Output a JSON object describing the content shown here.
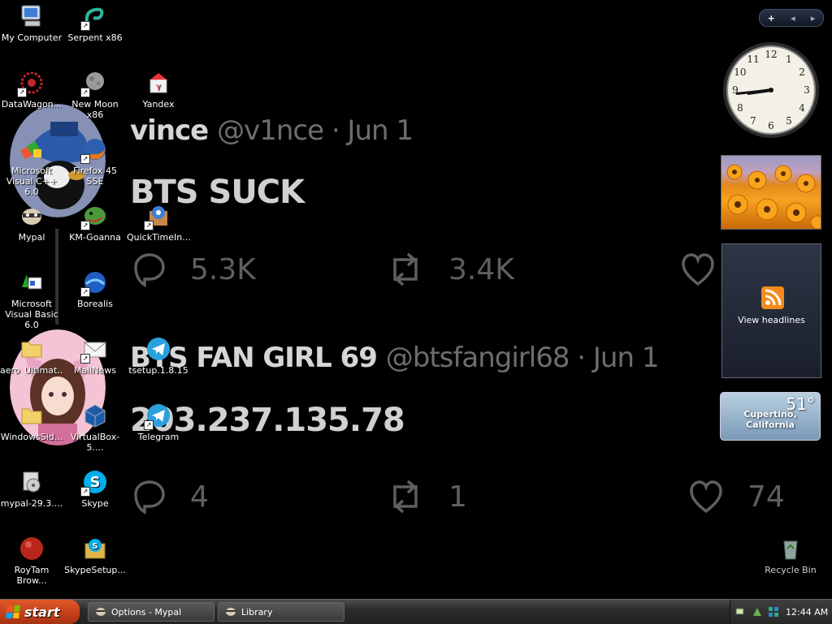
{
  "wallpaper": {
    "tweet1": {
      "name": "vince",
      "handle": "@v1nce · Jun 1",
      "body": "BTS SUCK",
      "replies": "5.3K",
      "retweets": "3.4K"
    },
    "tweet2": {
      "name": "BTS FAN GIRL 69",
      "handle": "@btsfangirl68 · Jun 1",
      "body": "203.237.135.78",
      "replies": "4",
      "retweets": "1",
      "likes": "74"
    }
  },
  "desktop_icons": [
    {
      "id": "my-computer",
      "label": "My Computer",
      "icon": "computer-icon"
    },
    {
      "id": "serpent",
      "label": "Serpent x86",
      "icon": "serpent-icon"
    },
    {
      "id": "datawagon",
      "label": "DataWagon...",
      "icon": "datawagon-icon"
    },
    {
      "id": "new-moon",
      "label": "New Moon x86",
      "icon": "moon-icon"
    },
    {
      "id": "yandex",
      "label": "Yandex",
      "icon": "yandex-icon"
    },
    {
      "id": "msvc",
      "label": "Microsoft Visual C++ 6.0",
      "icon": "visual-cpp-icon"
    },
    {
      "id": "firefox",
      "label": "Firefox 45 SSE",
      "icon": "firefox-icon"
    },
    {
      "id": "mypal",
      "label": "Mypal",
      "icon": "mypal-icon"
    },
    {
      "id": "km-goanna",
      "label": "KM-Goanna",
      "icon": "goanna-icon"
    },
    {
      "id": "quicktime",
      "label": "QuickTimeIn...",
      "icon": "quicktime-icon"
    },
    {
      "id": "msvb",
      "label": "Microsoft Visual Basic 6.0",
      "icon": "visual-basic-icon"
    },
    {
      "id": "borealis",
      "label": "Borealis",
      "icon": "borealis-icon"
    },
    {
      "id": "aero",
      "label": "aero_Ultimat...",
      "icon": "folder-icon"
    },
    {
      "id": "mailnews",
      "label": "MailNews",
      "icon": "mail-icon"
    },
    {
      "id": "tsetup",
      "label": "tsetup.1.8.15",
      "icon": "telegram-icon"
    },
    {
      "id": "windowssid",
      "label": "WindowsSid...",
      "icon": "folder-icon"
    },
    {
      "id": "virtualbox",
      "label": "VirtualBox-5....",
      "icon": "virtualbox-icon"
    },
    {
      "id": "telegram",
      "label": "Telegram",
      "icon": "telegram-icon"
    },
    {
      "id": "mypal-setup",
      "label": "mypal-29.3....",
      "icon": "installer-icon"
    },
    {
      "id": "skype",
      "label": "Skype",
      "icon": "skype-icon"
    },
    {
      "id": "roytam",
      "label": "RoyTam Brow...",
      "icon": "roytam-icon"
    },
    {
      "id": "skype-setup",
      "label": "SkypeSetup...",
      "icon": "skype-setup-icon"
    },
    {
      "id": "recycle-bin",
      "label": "Recycle Bin",
      "icon": "recycle-bin-icon"
    }
  ],
  "gadgets": {
    "controls": {
      "add": "+",
      "prev": "◂",
      "next": "▸"
    },
    "clock": {
      "hour": 8,
      "minute": 44,
      "numerals": [
        "12",
        "1",
        "2",
        "3",
        "4",
        "5",
        "6",
        "7",
        "8",
        "9",
        "10",
        "11"
      ]
    },
    "feed": {
      "label": "View headlines"
    },
    "weather": {
      "temp": "51°",
      "city": "Cupertino, California"
    }
  },
  "taskbar": {
    "start_label": "start",
    "tasks": [
      {
        "label": "Options - Mypal",
        "icon": "mypal-icon"
      },
      {
        "label": "Library",
        "icon": "library-icon"
      }
    ],
    "time": "12:44 AM"
  },
  "colors": {
    "start": "#d2481f",
    "feed_icon": "#f48a1b",
    "telegram": "#2aa1de",
    "skype": "#00aff0"
  }
}
